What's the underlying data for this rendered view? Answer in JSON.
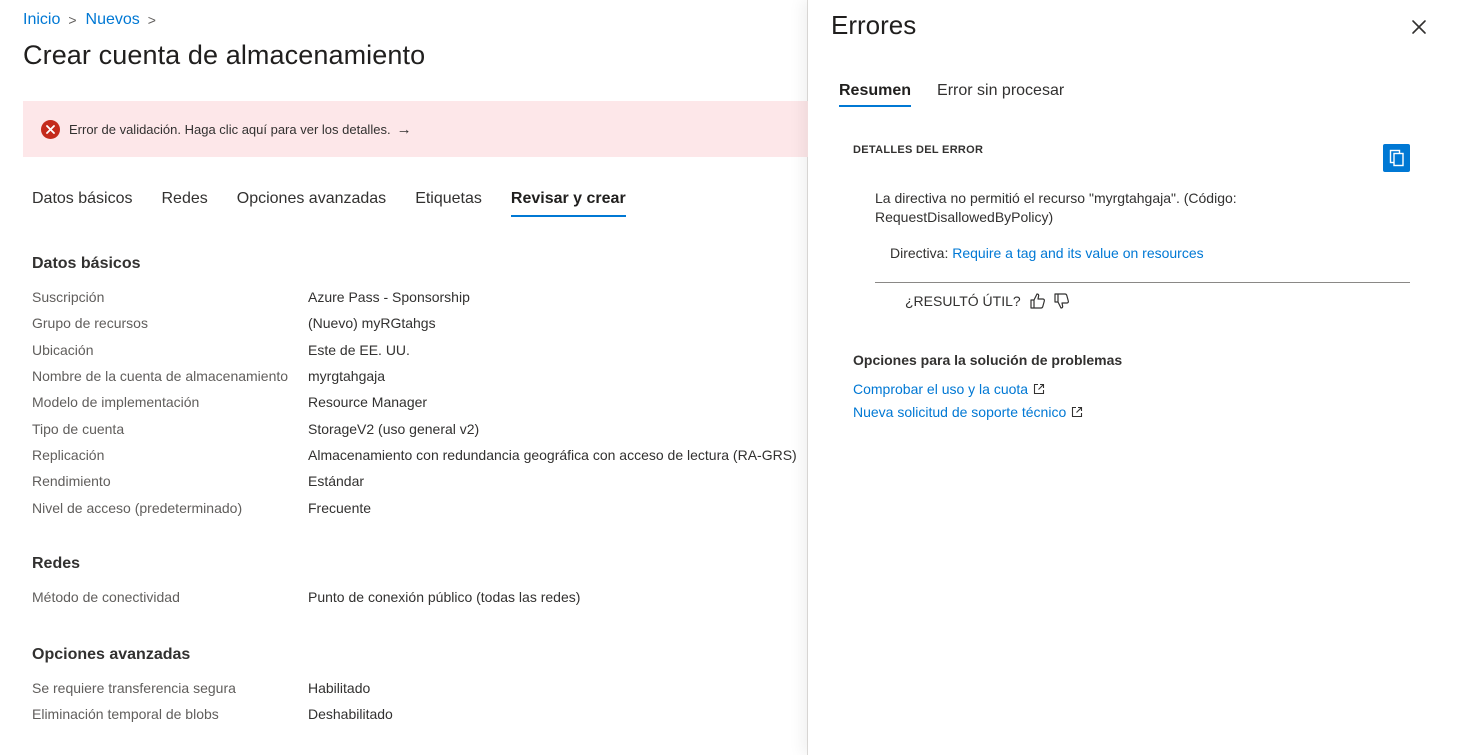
{
  "breadcrumb": {
    "items": [
      "Inicio",
      "Nuevos"
    ],
    "separator": ">"
  },
  "page_title": "Crear cuenta de almacenamiento",
  "alert": {
    "message": "Error de validación. Haga clic aquí para ver los detalles.",
    "arrow": "→",
    "color": "#c42b1c",
    "background": "#fde7e9"
  },
  "tabs": {
    "items": [
      "Datos básicos",
      "Redes",
      "Opciones avanzadas",
      "Etiquetas",
      "Revisar y crear"
    ],
    "active": "Revisar y crear"
  },
  "sections": {
    "basics": {
      "title": "Datos básicos",
      "rows": [
        {
          "label": "Suscripción",
          "value": "Azure Pass - Sponsorship"
        },
        {
          "label": "Grupo de recursos",
          "value": "(Nuevo) myRGtahgs"
        },
        {
          "label": "Ubicación",
          "value": "Este de EE. UU."
        },
        {
          "label": "Nombre de la cuenta de almacenamiento",
          "value": "myrgtahgaja"
        },
        {
          "label": "Modelo de implementación",
          "value": "Resource Manager"
        },
        {
          "label": "Tipo de cuenta",
          "value": "StorageV2 (uso general v2)"
        },
        {
          "label": "Replicación",
          "value": "Almacenamiento con redundancia geográfica con acceso de lectura (RA-GRS)"
        },
        {
          "label": "Rendimiento",
          "value": "Estándar"
        },
        {
          "label": "Nivel de acceso (predeterminado)",
          "value": "Frecuente"
        }
      ]
    },
    "networking": {
      "title": "Redes",
      "rows": [
        {
          "label": "Método de conectividad",
          "value": "Punto de conexión público (todas las redes)"
        }
      ]
    },
    "advanced": {
      "title": "Opciones avanzadas",
      "rows": [
        {
          "label": "Se requiere transferencia segura",
          "value": "Habilitado"
        },
        {
          "label": "Eliminación temporal de blobs",
          "value": "Deshabilitado"
        }
      ]
    }
  },
  "panel": {
    "title": "Errores",
    "close_icon": "close-icon",
    "tabs": [
      "Resumen",
      "Error sin procesar"
    ],
    "active_tab": "Resumen",
    "details_header": "DETALLES DEL ERROR",
    "copy_icon": "copy-icon",
    "error_message": "La directiva no permitió el recurso \"myrgtahgaja\". (Código: RequestDisallowedByPolicy)",
    "directive_label": "Directiva:",
    "directive_link": "Require a tag and its value on resources",
    "helpful_question": "¿RESULTÓ ÚTIL?",
    "troubleshooting_title": "Opciones para la solución de problemas",
    "links": [
      "Comprobar el uso y la cuota",
      "Nueva solicitud de soporte técnico"
    ],
    "accent": "#0078d4"
  }
}
